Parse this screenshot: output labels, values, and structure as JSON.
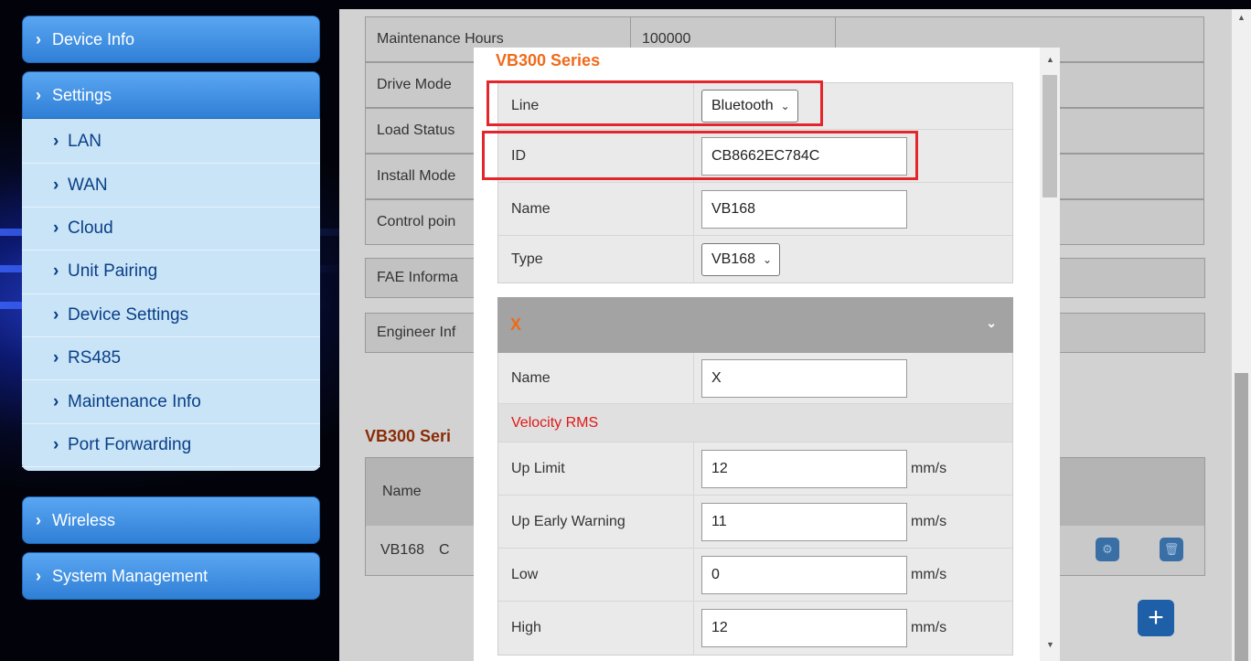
{
  "sidebar": {
    "items": [
      {
        "label": "Device Info"
      },
      {
        "label": "Settings"
      },
      {
        "label": "Wireless"
      },
      {
        "label": "System Management"
      }
    ],
    "settings_sub": [
      {
        "label": "LAN"
      },
      {
        "label": "WAN"
      },
      {
        "label": "Cloud"
      },
      {
        "label": "Unit Pairing"
      },
      {
        "label": "Device Settings"
      },
      {
        "label": "RS485"
      },
      {
        "label": "Maintenance Info"
      },
      {
        "label": "Port Forwarding"
      }
    ]
  },
  "main": {
    "info_rows": [
      {
        "key": "Maintenance Hours",
        "value": "100000"
      },
      {
        "key": "Drive Mode",
        "value": ""
      },
      {
        "key": "Load Status",
        "value": ""
      },
      {
        "key": "Install Mode",
        "value": ""
      },
      {
        "key": "Control poin",
        "value": ""
      }
    ],
    "fae_label": "FAE Informa",
    "engineer_label": "Engineer Inf",
    "vb_heading": "VB300 Seri",
    "vb_table": {
      "header": "Name",
      "row_name": "VB168",
      "row_second": "C"
    },
    "add_icon": "plus-icon"
  },
  "modal": {
    "title": "VB300 Series",
    "fields": {
      "line_label": "Line",
      "line_value": "Bluetooth",
      "id_label": "ID",
      "id_value": "CB8662EC784C",
      "name_label": "Name",
      "name_value": "VB168",
      "type_label": "Type",
      "type_value": "VB168"
    },
    "x_section": {
      "title": "X",
      "name_label": "Name",
      "name_value": "X",
      "velocity_heading": "Velocity RMS",
      "up_limit_label": "Up Limit",
      "up_limit_value": "12",
      "up_early_label": "Up Early Warning",
      "up_early_value": "11",
      "low_label": "Low",
      "low_value": "0",
      "high_label": "High",
      "high_value": "12",
      "unit": "mm/s"
    }
  },
  "colors": {
    "accent_orange": "#f06a1a",
    "highlight_red": "#e3262b",
    "velocity_red": "#e01818",
    "menu_blue": "#2f7fd6"
  }
}
